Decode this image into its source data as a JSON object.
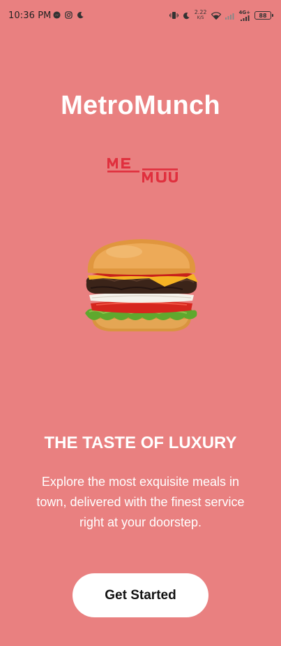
{
  "status_bar": {
    "time": "10:36 PM",
    "net_speed_value": "2.22",
    "net_speed_unit": "K/S",
    "network_type": "4G+",
    "battery": "88",
    "icons": [
      "messenger-icon",
      "instagram-icon",
      "moon-icon",
      "vibrate-icon",
      "moon-icon",
      "wifi-icon",
      "signal-icon",
      "signal-4g-icon",
      "battery-icon"
    ]
  },
  "app": {
    "title": "MetroMunch",
    "logo_text": "MEMU"
  },
  "hero": {
    "image": "burger-image"
  },
  "content": {
    "tagline": "THE TASTE OF LUXURY",
    "description": "Explore the most exquisite meals in town, delivered with the finest service right at your doorstep."
  },
  "actions": {
    "get_started_label": "Get Started"
  },
  "colors": {
    "background": "#E98080",
    "logo_red": "#E0303E",
    "button_bg": "#FFFFFF",
    "text_white": "#FFFFFF"
  }
}
